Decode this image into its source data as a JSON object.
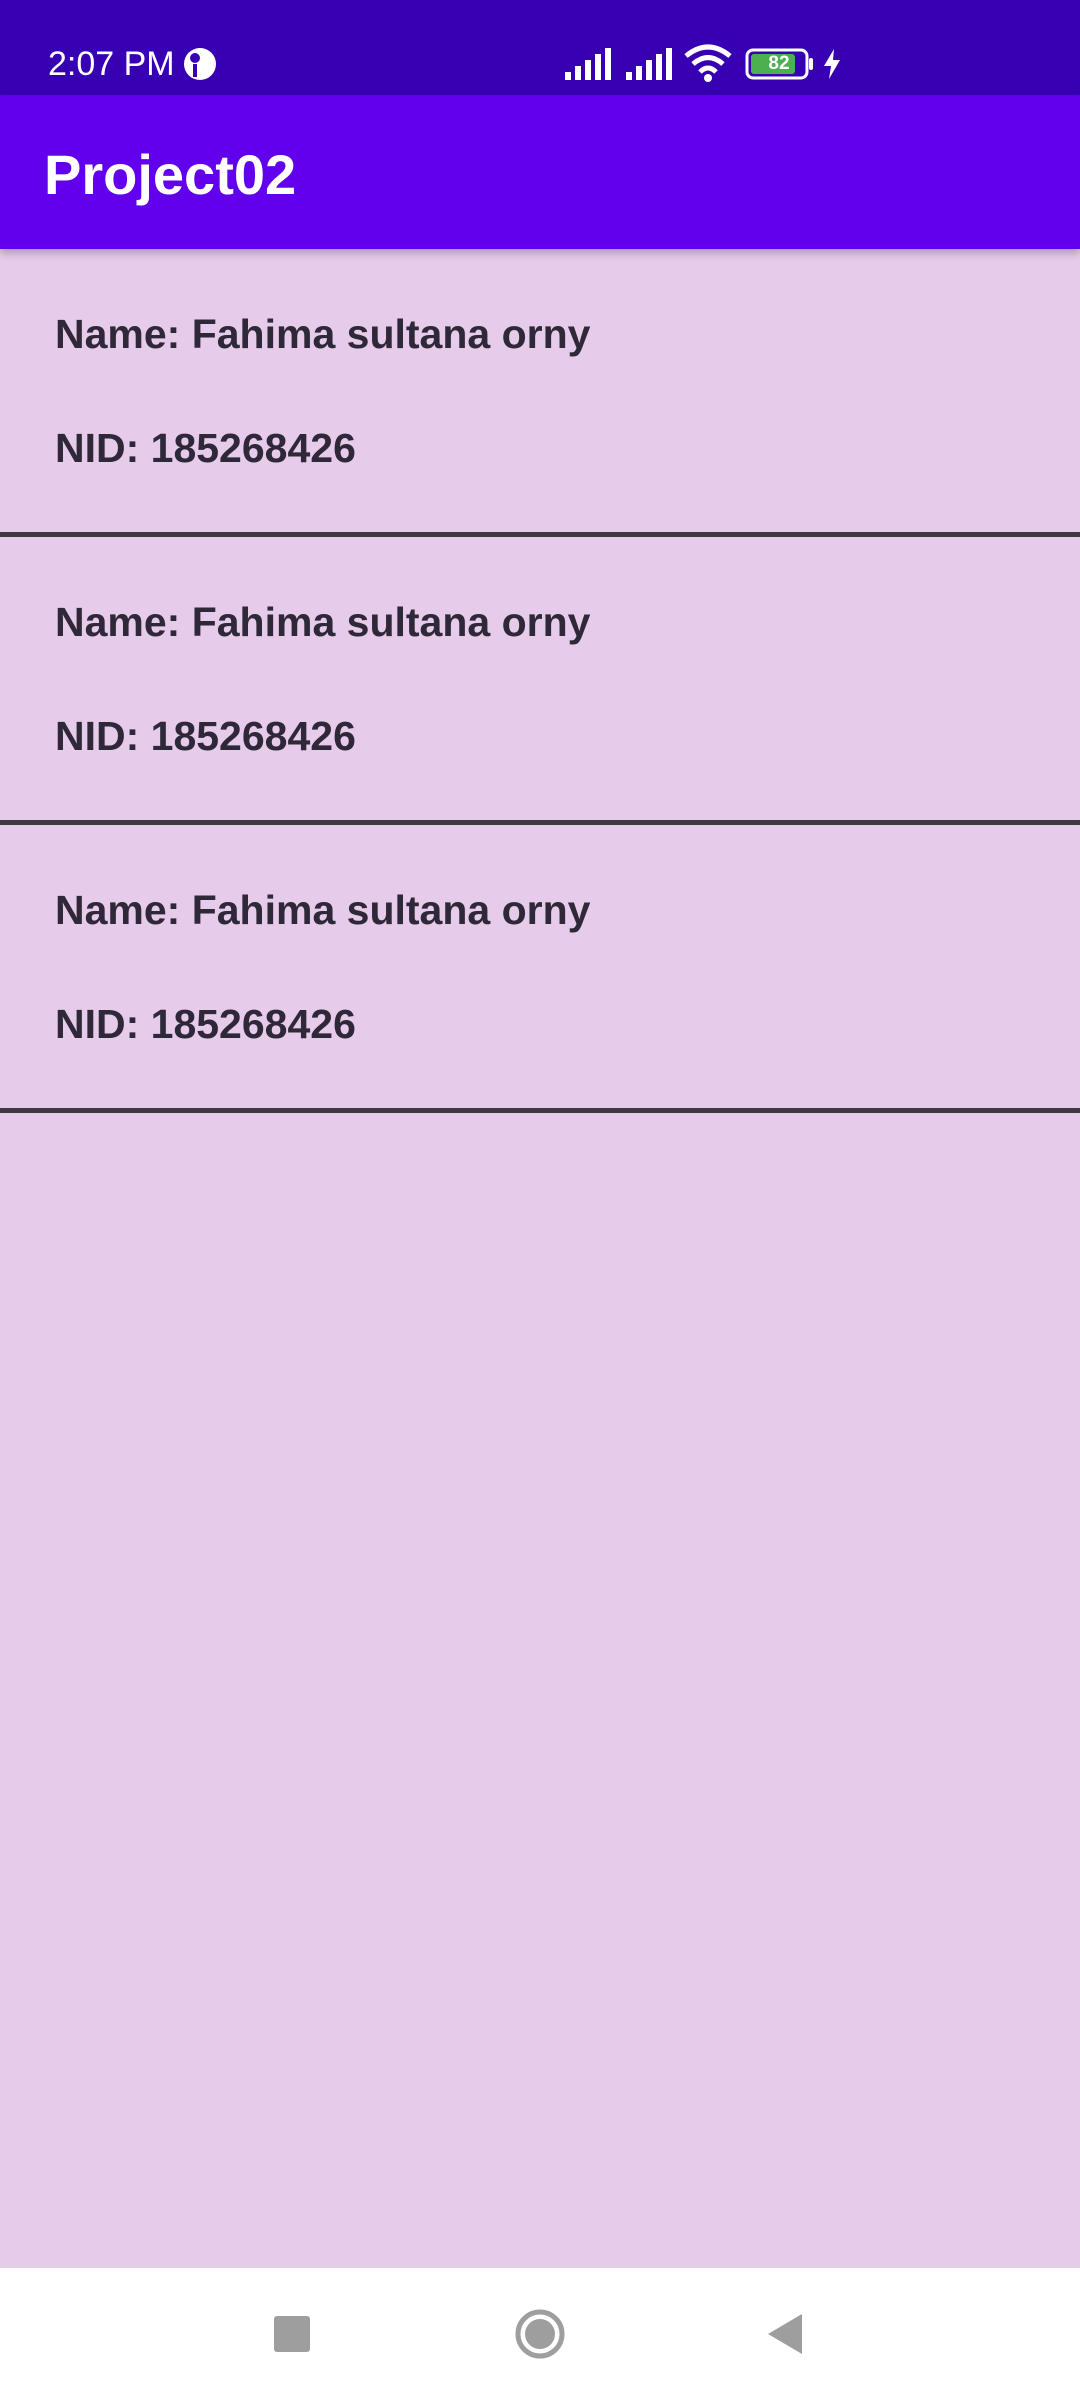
{
  "status_bar": {
    "time": "2:07 PM",
    "battery": "82",
    "icons": [
      "app-notification-icon",
      "signal-icon",
      "signal-icon",
      "wifi-icon",
      "battery-icon",
      "charging-icon"
    ]
  },
  "app_bar": {
    "title": "Project02"
  },
  "list": {
    "items": [
      {
        "name": "Name: Fahima sultana orny",
        "nid": "NID: 185268426"
      },
      {
        "name": "Name: Fahima sultana orny",
        "nid": "NID: 185268426"
      },
      {
        "name": "Name: Fahima sultana orny",
        "nid": "NID: 185268426"
      }
    ]
  },
  "nav_bar": {
    "buttons": [
      "recents-icon",
      "home-icon",
      "back-icon"
    ]
  },
  "colors": {
    "status_bar": "#3700B3",
    "app_bar": "#6200EE",
    "background": "#E6CBEA",
    "divider": "#3C3A40",
    "text": "#2E2838"
  }
}
